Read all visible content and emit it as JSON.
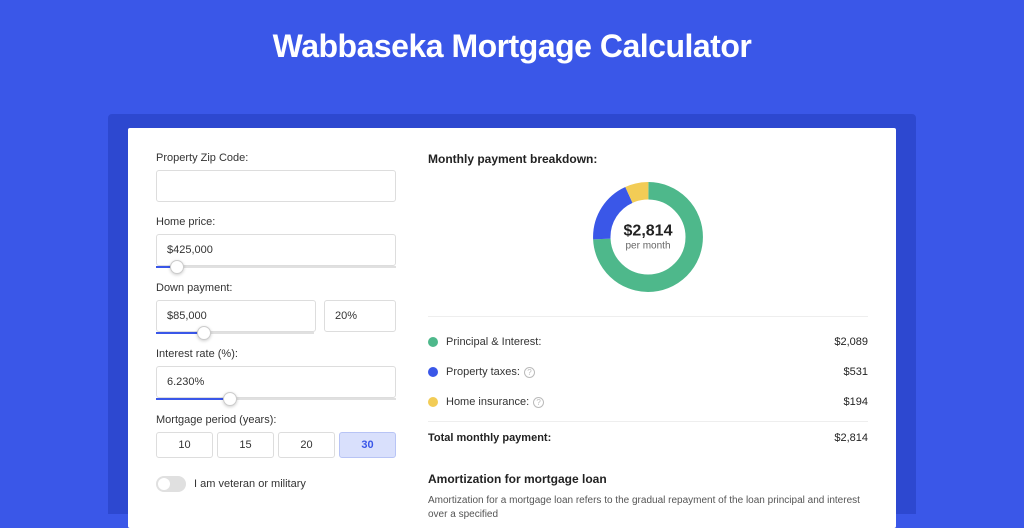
{
  "title": "Wabbaseka Mortgage Calculator",
  "form": {
    "zip_label": "Property Zip Code:",
    "zip_value": "",
    "home_price_label": "Home price:",
    "home_price_value": "$425,000",
    "down_payment_label": "Down payment:",
    "down_payment_value": "$85,000",
    "down_payment_pct": "20%",
    "interest_label": "Interest rate (%):",
    "interest_value": "6.230%",
    "period_label": "Mortgage period (years):",
    "periods": [
      "10",
      "15",
      "20",
      "30"
    ],
    "period_selected": "30",
    "veteran_label": "I am veteran or military"
  },
  "breakdown": {
    "title": "Monthly payment breakdown:",
    "total": "$2,814",
    "sub": "per month",
    "items": [
      {
        "label": "Principal & Interest:",
        "value": "$2,089",
        "color": "#4eb88b",
        "info": false
      },
      {
        "label": "Property taxes:",
        "value": "$531",
        "color": "#3a57e8",
        "info": true
      },
      {
        "label": "Home insurance:",
        "value": "$194",
        "color": "#f2cc56",
        "info": true
      }
    ],
    "total_label": "Total monthly payment:",
    "total_value": "$2,814"
  },
  "chart_data": {
    "type": "pie",
    "title": "Monthly payment breakdown",
    "series": [
      {
        "name": "Principal & Interest",
        "value": 2089,
        "color": "#4eb88b"
      },
      {
        "name": "Property taxes",
        "value": 531,
        "color": "#3a57e8"
      },
      {
        "name": "Home insurance",
        "value": 194,
        "color": "#f2cc56"
      }
    ],
    "total": 2814,
    "center_label": "$2,814",
    "center_sub": "per month"
  },
  "amortization": {
    "title": "Amortization for mortgage loan",
    "text": "Amortization for a mortgage loan refers to the gradual repayment of the loan principal and interest over a specified"
  }
}
